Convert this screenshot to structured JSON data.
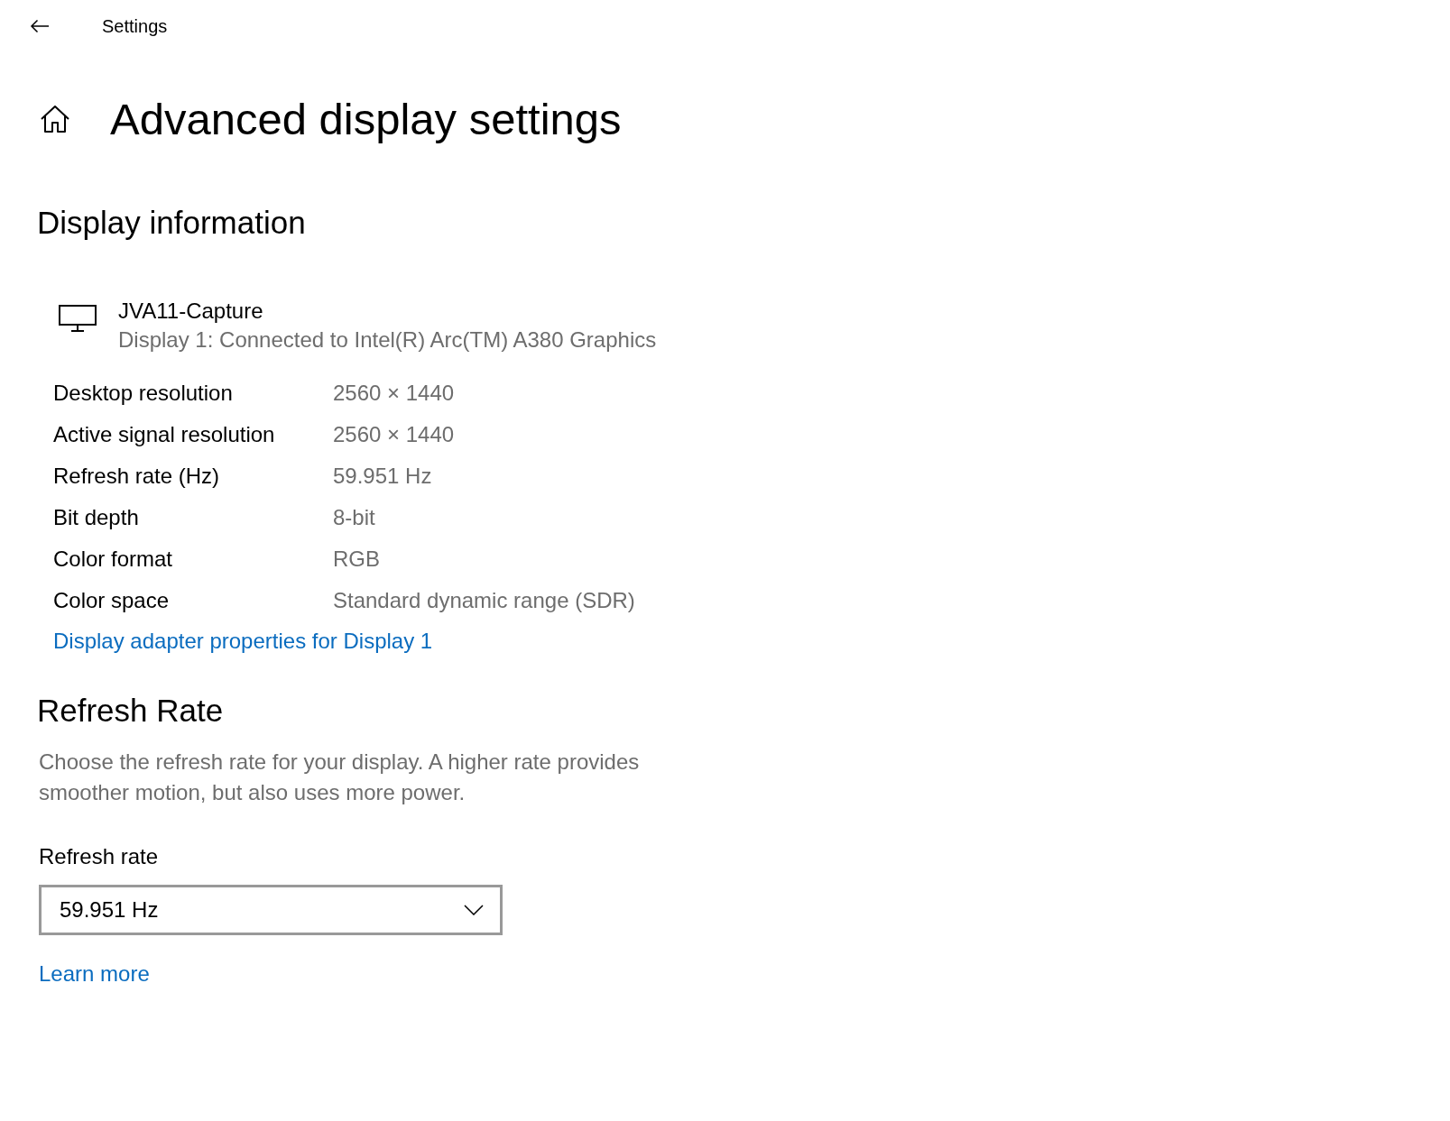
{
  "header": {
    "title": "Settings"
  },
  "page": {
    "title": "Advanced display settings"
  },
  "display_information": {
    "heading": "Display information",
    "display": {
      "name": "JVA11-Capture",
      "description": "Display 1: Connected to Intel(R) Arc(TM) A380 Graphics"
    },
    "properties": [
      {
        "label": "Desktop resolution",
        "value": "2560 × 1440"
      },
      {
        "label": "Active signal resolution",
        "value": "2560 × 1440"
      },
      {
        "label": "Refresh rate (Hz)",
        "value": "59.951 Hz"
      },
      {
        "label": "Bit depth",
        "value": "8-bit"
      },
      {
        "label": "Color format",
        "value": "RGB"
      },
      {
        "label": "Color space",
        "value": "Standard dynamic range (SDR)"
      }
    ],
    "link": "Display adapter properties for Display 1"
  },
  "refresh_rate": {
    "heading": "Refresh Rate",
    "description": "Choose the refresh rate for your display. A higher rate provides smoother motion, but also uses more power.",
    "field": {
      "label": "Refresh rate",
      "value": "59.951 Hz"
    },
    "link": "Learn more"
  }
}
